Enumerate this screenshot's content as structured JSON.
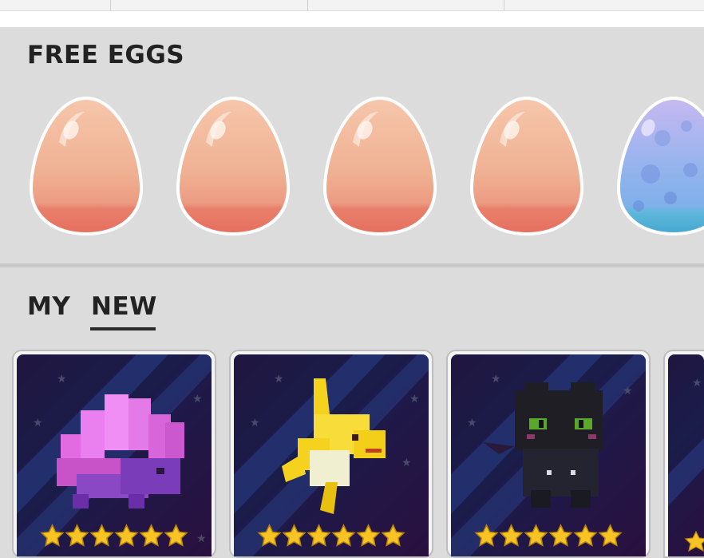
{
  "sections": {
    "free_eggs_title": "FREE EGGS",
    "my_tab_label": "MY",
    "new_tab_label": "NEW"
  },
  "eggs": [
    {
      "type": "common-egg",
      "color": "#f3b99a"
    },
    {
      "type": "common-egg",
      "color": "#f3b99a"
    },
    {
      "type": "common-egg",
      "color": "#f3b99a"
    },
    {
      "type": "common-egg",
      "color": "#f3b99a"
    },
    {
      "type": "rare-egg",
      "color": "#9ab8f0"
    }
  ],
  "pets": [
    {
      "name": "crystal-pet",
      "icon": "pink-crystal-creature-icon",
      "stars": 6
    },
    {
      "name": "yellow-shark-pet",
      "icon": "yellow-shark-icon",
      "stars": 6
    },
    {
      "name": "black-bat-pet",
      "icon": "black-bat-creature-icon",
      "stars": 6
    }
  ],
  "colors": {
    "panel_bg": "#dcdcdc",
    "title": "#222222",
    "card_bg": "#1e1a48",
    "star": "#f7c325"
  }
}
